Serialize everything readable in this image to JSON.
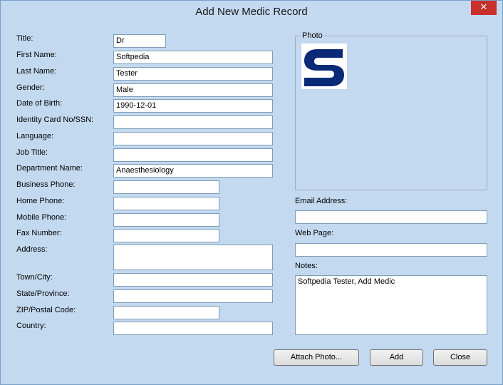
{
  "window": {
    "title": "Add New Medic Record",
    "close_glyph": "✕"
  },
  "form": {
    "title": {
      "label": "Title:",
      "value": "Dr"
    },
    "first_name": {
      "label": "First Name:",
      "value": "Softpedia"
    },
    "last_name": {
      "label": "Last Name:",
      "value": "Tester"
    },
    "gender": {
      "label": "Gender:",
      "value": "Male"
    },
    "dob": {
      "label": "Date of Birth:",
      "value": "1990-12-01"
    },
    "id_card": {
      "label": "Identity Card No/SSN:",
      "value": ""
    },
    "language": {
      "label": "Language:",
      "value": ""
    },
    "job_title": {
      "label": "Job Title:",
      "value": ""
    },
    "department": {
      "label": "Department Name:",
      "value": "Anaesthesiology"
    },
    "business_phone": {
      "label": "Business Phone:",
      "value": ""
    },
    "home_phone": {
      "label": "Home Phone:",
      "value": ""
    },
    "mobile_phone": {
      "label": "Mobile Phone:",
      "value": ""
    },
    "fax": {
      "label": "Fax Number:",
      "value": ""
    },
    "address": {
      "label": "Address:",
      "value": ""
    },
    "town": {
      "label": "Town/City:",
      "value": ""
    },
    "state": {
      "label": "State/Province:",
      "value": ""
    },
    "zip": {
      "label": "ZIP/Postal Code:",
      "value": ""
    },
    "country": {
      "label": "Country:",
      "value": ""
    }
  },
  "right": {
    "photo_label": "Photo",
    "email": {
      "label": "Email Address:",
      "value": ""
    },
    "web": {
      "label": "Web Page:",
      "value": ""
    },
    "notes": {
      "label": "Notes:",
      "value": "Softpedia Tester, Add Medic"
    }
  },
  "buttons": {
    "attach": "Attach Photo...",
    "add": "Add",
    "close": "Close"
  },
  "colors": {
    "logo": "#0a2a78",
    "close": "#c7302b"
  }
}
